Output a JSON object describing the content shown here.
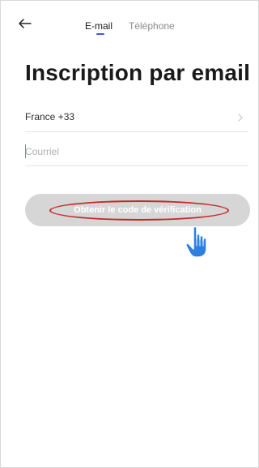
{
  "header": {
    "back_icon": "arrow-left-icon",
    "tabs": [
      {
        "label": "E-mail",
        "active": true
      },
      {
        "label": "Téléphone",
        "active": false
      }
    ],
    "accent_color": "#3b5bdb"
  },
  "main": {
    "title": "Inscription par email",
    "country": {
      "value": "France +33",
      "icon": "chevron-right-icon"
    },
    "email": {
      "placeholder": "Courriel",
      "value": ""
    },
    "button": {
      "label": "Obtenir le code de vérification",
      "enabled": false,
      "color": "#d6d6d6"
    }
  },
  "annotation": {
    "ellipse_color": "#c62828",
    "pointer_icon": "hand-pointer-icon",
    "pointer_color": "#2f7fe0"
  }
}
